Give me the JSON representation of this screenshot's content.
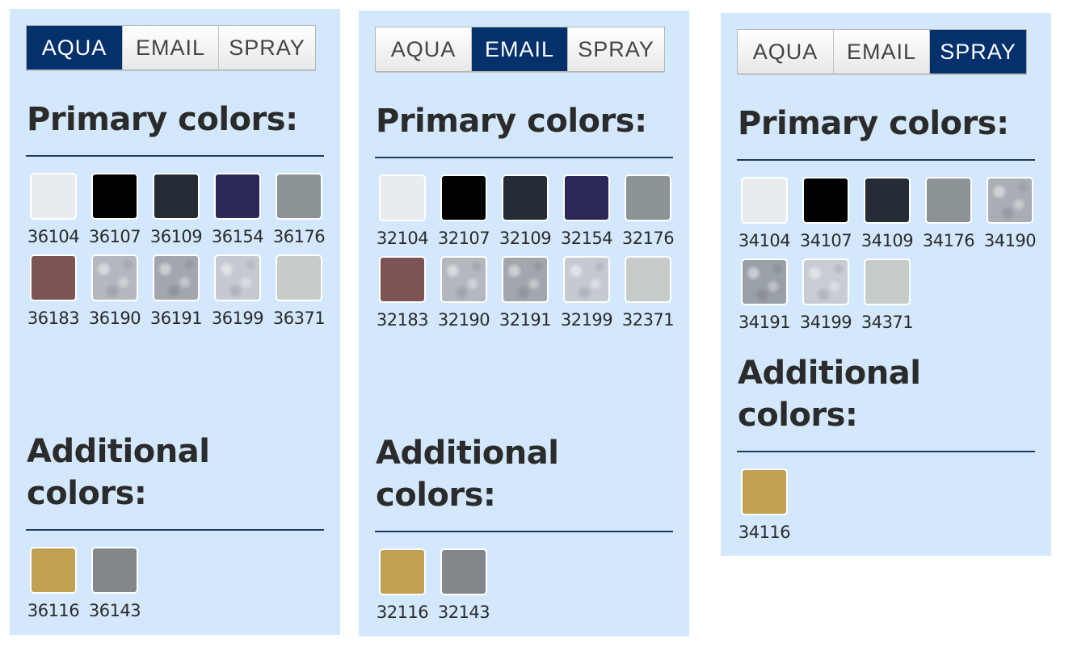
{
  "panels": [
    {
      "tabs": [
        {
          "label": "AQUA",
          "active": true
        },
        {
          "label": "EMAIL",
          "active": false
        },
        {
          "label": "SPRAY",
          "active": false
        }
      ],
      "primary_heading": "Primary colors:",
      "additional_heading": "Additional colors:",
      "primary_colors": [
        {
          "code": "36104",
          "color": "#e9ecef"
        },
        {
          "code": "36107",
          "color": "#000000"
        },
        {
          "code": "36109",
          "color": "#262c35"
        },
        {
          "code": "36154",
          "color": "#2c2858"
        },
        {
          "code": "36176",
          "color": "#8a9396"
        },
        {
          "code": "36183",
          "color": "#7d5353"
        },
        {
          "code": "36190",
          "color": "#b3b8bf",
          "texture": "metallic"
        },
        {
          "code": "36191",
          "color": "#a2a7ae",
          "texture": "metallic"
        },
        {
          "code": "36199",
          "color": "#c5cad2",
          "texture": "metallic"
        },
        {
          "code": "36371",
          "color": "#c6cdc9"
        }
      ],
      "additional_colors": [
        {
          "code": "36116",
          "color": "#c1a054"
        },
        {
          "code": "36143",
          "color": "#81878a"
        }
      ]
    },
    {
      "tabs": [
        {
          "label": "AQUA",
          "active": false
        },
        {
          "label": "EMAIL",
          "active": true
        },
        {
          "label": "SPRAY",
          "active": false
        }
      ],
      "primary_heading": "Primary colors:",
      "additional_heading": "Additional colors:",
      "primary_colors": [
        {
          "code": "32104",
          "color": "#e9ecef"
        },
        {
          "code": "32107",
          "color": "#000000"
        },
        {
          "code": "32109",
          "color": "#262c35"
        },
        {
          "code": "32154",
          "color": "#2c2858"
        },
        {
          "code": "32176",
          "color": "#8a9396"
        },
        {
          "code": "32183",
          "color": "#7d5353"
        },
        {
          "code": "32190",
          "color": "#b3b8bf",
          "texture": "metallic"
        },
        {
          "code": "32191",
          "color": "#a2a7ae",
          "texture": "metallic"
        },
        {
          "code": "32199",
          "color": "#c5cad2",
          "texture": "metallic"
        },
        {
          "code": "32371",
          "color": "#c6cdc9"
        }
      ],
      "additional_colors": [
        {
          "code": "32116",
          "color": "#c1a054"
        },
        {
          "code": "32143",
          "color": "#81878a"
        }
      ]
    },
    {
      "tabs": [
        {
          "label": "AQUA",
          "active": false
        },
        {
          "label": "EMAIL",
          "active": false
        },
        {
          "label": "SPRAY",
          "active": true
        }
      ],
      "primary_heading": "Primary colors:",
      "additional_heading": "Additional colors:",
      "primary_colors": [
        {
          "code": "34104",
          "color": "#e9ecef"
        },
        {
          "code": "34107",
          "color": "#000000"
        },
        {
          "code": "34109",
          "color": "#262c35"
        },
        {
          "code": "34176",
          "color": "#8a9396"
        },
        {
          "code": "34190",
          "color": "#a9aeb5",
          "texture": "metallic"
        },
        {
          "code": "34191",
          "color": "#9aa0a7",
          "texture": "metallic"
        },
        {
          "code": "34199",
          "color": "#c8ccd3",
          "texture": "metallic"
        },
        {
          "code": "34371",
          "color": "#c6cdc9"
        }
      ],
      "additional_colors": [
        {
          "code": "34116",
          "color": "#c1a054"
        }
      ]
    }
  ]
}
